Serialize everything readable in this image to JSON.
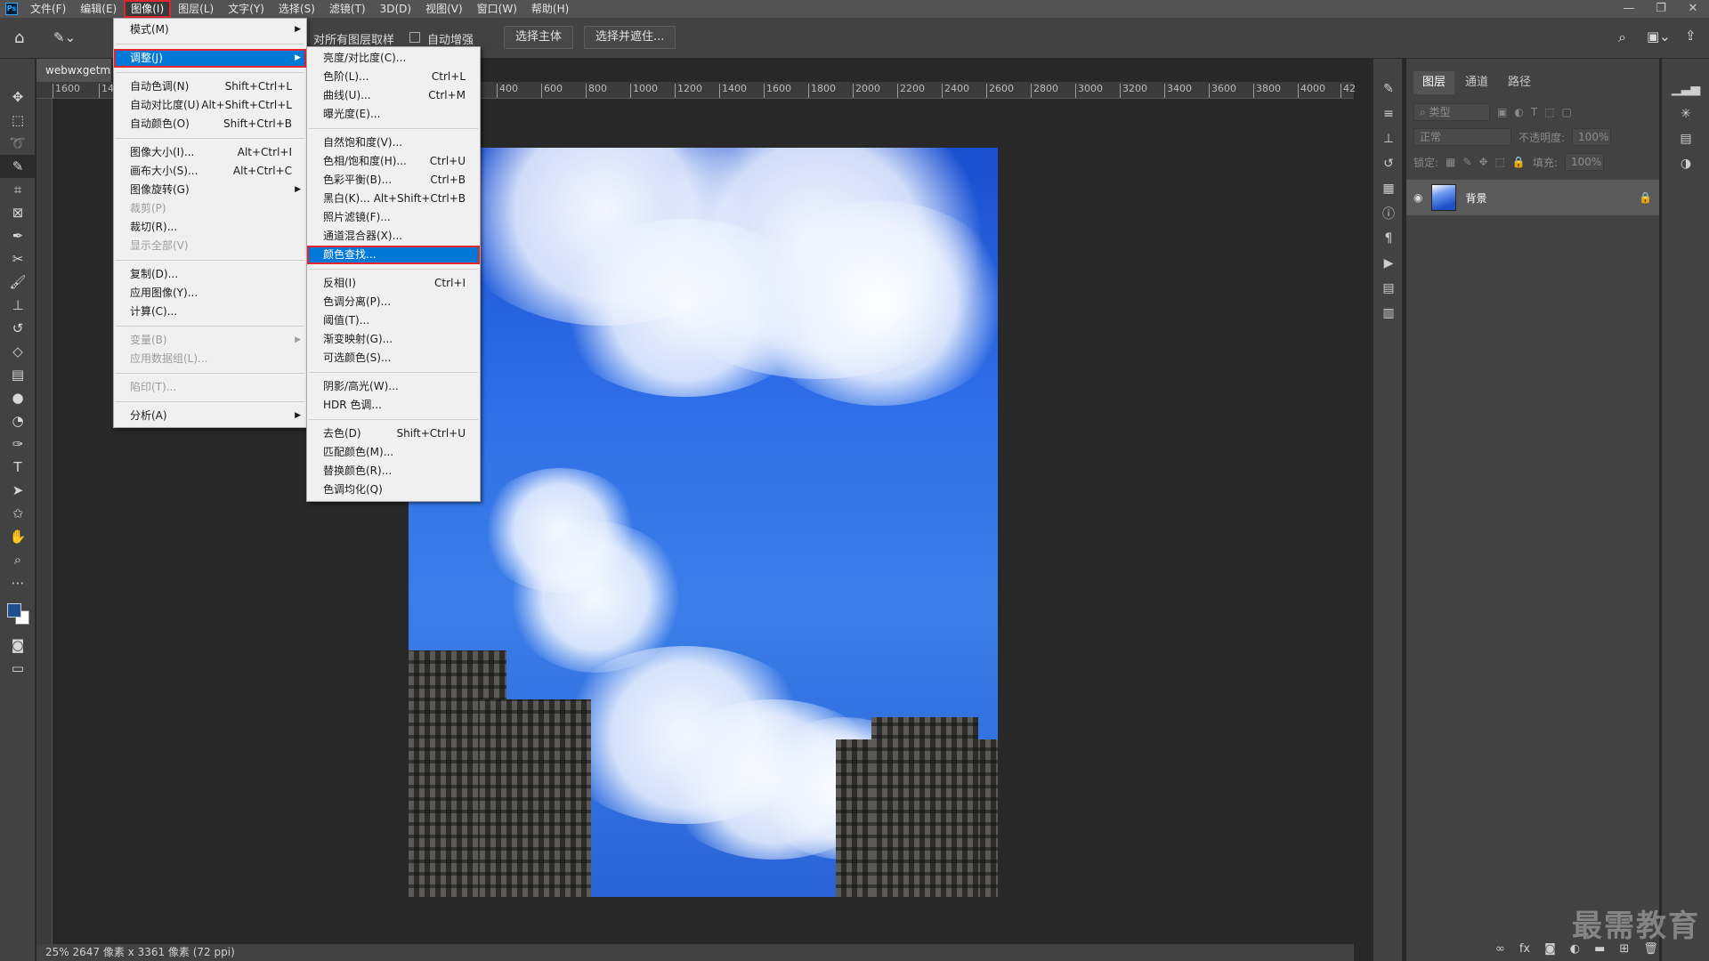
{
  "menubar": {
    "logo": "Ps",
    "items": [
      "文件(F)",
      "编辑(E)",
      "图像(I)",
      "图层(L)",
      "文字(Y)",
      "选择(S)",
      "滤镜(T)",
      "3D(D)",
      "视图(V)",
      "窗口(W)",
      "帮助(H)"
    ],
    "active_index": 2
  },
  "window_controls": {
    "minimize": "—",
    "restore": "❐",
    "close": "✕"
  },
  "options_bar": {
    "sample_all_layers": "对所有图层取样",
    "auto_enhance": "自动增强",
    "select_subject": "选择主体",
    "select_and_mask": "选择并遮住..."
  },
  "document": {
    "tab_title": "webwxgetms",
    "status": "25%   2647 像素 x 3361 像素 (72 ppi)"
  },
  "ruler": {
    "h_ticks": [
      "1600",
      "14",
      "400",
      "600",
      "800",
      "1000",
      "1200",
      "1400",
      "1600",
      "1800",
      "2000",
      "2200",
      "2400",
      "2600",
      "2800",
      "3000",
      "3200",
      "3400",
      "3600",
      "3800",
      "4000",
      "42"
    ]
  },
  "image_menu": [
    {
      "label": "模式(M)",
      "arrow": true
    },
    {
      "sep": true
    },
    {
      "label": "调整(J)",
      "arrow": true,
      "highlight": true
    },
    {
      "sep": true
    },
    {
      "label": "自动色调(N)",
      "shortcut": "Shift+Ctrl+L"
    },
    {
      "label": "自动对比度(U)",
      "shortcut": "Alt+Shift+Ctrl+L"
    },
    {
      "label": "自动颜色(O)",
      "shortcut": "Shift+Ctrl+B"
    },
    {
      "sep": true
    },
    {
      "label": "图像大小(I)...",
      "shortcut": "Alt+Ctrl+I"
    },
    {
      "label": "画布大小(S)...",
      "shortcut": "Alt+Ctrl+C"
    },
    {
      "label": "图像旋转(G)",
      "arrow": true
    },
    {
      "label": "裁剪(P)",
      "disabled": true
    },
    {
      "label": "裁切(R)..."
    },
    {
      "label": "显示全部(V)",
      "disabled": true
    },
    {
      "sep": true
    },
    {
      "label": "复制(D)..."
    },
    {
      "label": "应用图像(Y)..."
    },
    {
      "label": "计算(C)..."
    },
    {
      "sep": true
    },
    {
      "label": "变量(B)",
      "arrow": true,
      "disabled": true
    },
    {
      "label": "应用数据组(L)...",
      "disabled": true
    },
    {
      "sep": true
    },
    {
      "label": "陷印(T)...",
      "disabled": true
    },
    {
      "sep": true
    },
    {
      "label": "分析(A)",
      "arrow": true
    }
  ],
  "adjust_menu": [
    {
      "label": "亮度/对比度(C)..."
    },
    {
      "label": "色阶(L)...",
      "shortcut": "Ctrl+L"
    },
    {
      "label": "曲线(U)...",
      "shortcut": "Ctrl+M"
    },
    {
      "label": "曝光度(E)..."
    },
    {
      "sep": true
    },
    {
      "label": "自然饱和度(V)..."
    },
    {
      "label": "色相/饱和度(H)...",
      "shortcut": "Ctrl+U"
    },
    {
      "label": "色彩平衡(B)...",
      "shortcut": "Ctrl+B"
    },
    {
      "label": "黑白(K)...",
      "shortcut": "Alt+Shift+Ctrl+B"
    },
    {
      "label": "照片滤镜(F)..."
    },
    {
      "label": "通道混合器(X)..."
    },
    {
      "label": "颜色查找...",
      "highlight": true
    },
    {
      "sep": true
    },
    {
      "label": "反相(I)",
      "shortcut": "Ctrl+I"
    },
    {
      "label": "色调分离(P)..."
    },
    {
      "label": "阈值(T)..."
    },
    {
      "label": "渐变映射(G)..."
    },
    {
      "label": "可选颜色(S)..."
    },
    {
      "sep": true
    },
    {
      "label": "阴影/高光(W)..."
    },
    {
      "label": "HDR 色调..."
    },
    {
      "sep": true
    },
    {
      "label": "去色(D)",
      "shortcut": "Shift+Ctrl+U"
    },
    {
      "label": "匹配颜色(M)..."
    },
    {
      "label": "替换颜色(R)..."
    },
    {
      "label": "色调均化(Q)"
    }
  ],
  "layers_panel": {
    "tabs": [
      "图层",
      "通道",
      "路径"
    ],
    "filter_placeholder": "类型",
    "blend_mode": "正常",
    "opacity_label": "不透明度:",
    "opacity_value": "100%",
    "lock_label": "锁定:",
    "fill_label": "填充:",
    "fill_value": "100%",
    "layer_name": "背景"
  },
  "watermark": "最需教育",
  "colors": {
    "highlight_blue": "#0078d7",
    "annotation_red": "#e0262f",
    "foreground": "#1f4f8f",
    "background": "#ffffff"
  }
}
